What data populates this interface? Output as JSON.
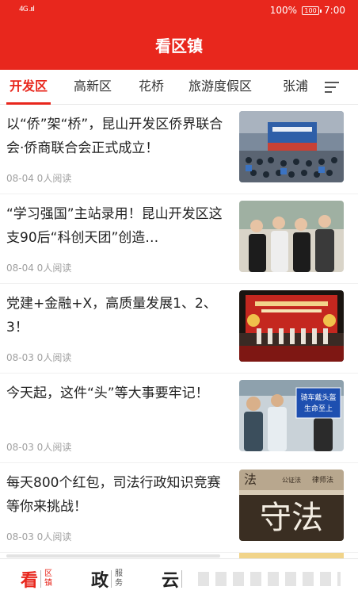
{
  "status_bar": {
    "signal": "4G .ııl",
    "battery_percent": "100%",
    "battery_icon_text": "100",
    "time": "7:00"
  },
  "app_bar": {
    "title": "看区镇"
  },
  "tabs": [
    {
      "label": "开发区",
      "active": true
    },
    {
      "label": "高新区",
      "active": false
    },
    {
      "label": "花桥",
      "active": false
    },
    {
      "label": "旅游度假区",
      "active": false
    },
    {
      "label": "张浦",
      "active": false
    }
  ],
  "news": [
    {
      "title": "以“侨”架“桥”，昆山开发区侨界联合会·侨商联合会正式成立！",
      "meta": "08-04 0人阅读"
    },
    {
      "title": "“学习强国”主站录用！昆山开发区这支90后“科创天团”创造…",
      "meta": "08-04 0人阅读"
    },
    {
      "title": "党建+金融+X，高质量发展1、2、3！",
      "meta": "08-03 0人阅读"
    },
    {
      "title": "今天起，这件“头”等大事要牢记！",
      "meta": "08-03 0人阅读"
    },
    {
      "title": "每天800个红包，司法行政知识竞赛等你来挑战！",
      "meta": "08-03 0人阅读"
    }
  ],
  "thumb_text": {
    "t4_sign_top": "骑车戴头盔",
    "t4_sign_bottom": "生命至上",
    "t5_big": "守法",
    "t5_small_left": "法",
    "t5_small_right": "律师法",
    "t5_small_mid": "公证法"
  },
  "bottom_nav": [
    {
      "big": "看",
      "small": "区镇",
      "active": true
    },
    {
      "big": "政",
      "small": "服务",
      "active": false
    },
    {
      "big": "云",
      "small": "",
      "active": false
    }
  ],
  "colors": {
    "brand_red": "#e8271d"
  }
}
